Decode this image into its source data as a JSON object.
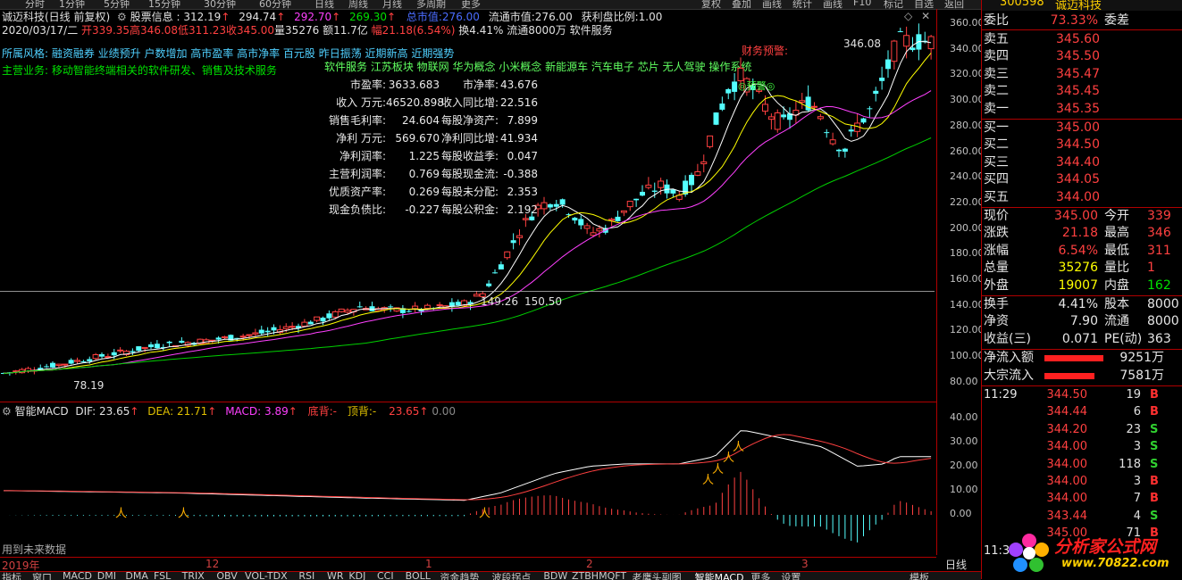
{
  "top_menu": {
    "left_items": [
      "分时",
      "1分钟",
      "5分钟",
      "15分钟",
      "30分钟",
      "60分钟",
      "日线",
      "周线",
      "月线",
      "多周期",
      "更多"
    ],
    "right_items": [
      "复权",
      "叠加",
      "画线",
      "统计",
      "画线",
      "F10",
      "标记",
      "自选",
      "返回"
    ]
  },
  "header": {
    "stock_label": "诚迈科技(日线 前复权)",
    "indicator_name": "股票信息",
    "v1": "312.19",
    "v2": "294.74",
    "v3": "292.70",
    "v4": "269.30",
    "total_mv_label": "总市值:",
    "total_mv": "276.00",
    "float_mv_label": "流通市值:",
    "float_mv": "276.00",
    "profit_ratio_label": "获利盘比例:",
    "profit_ratio": "1.00"
  },
  "quote_line": {
    "date": "2020/03/17/二",
    "open": "开339.35",
    "high": "高346.08",
    "low": "低311.23",
    "close": "收345.00",
    "volume": "量35276",
    "amount": "额11.7亿",
    "change": "幅21.18(6.54%)",
    "turnover": "换4.41%",
    "float_shares": "流通8000万",
    "industry": "软件服务"
  },
  "style_tags": "所属风格: 融资融券 业绩预升 户数增加 高市盈率 高市净率 百元股 昨日振荡 近期新高 近期强势",
  "concept_tags": "软件服务 江苏板块 物联网 华为概念 小米概念 新能源车 汽车电子 芯片 无人驾驶 操作系统",
  "main_business_label": "主营业务:",
  "main_business": "移动智能终端相关的软件研发、销售及技术服务",
  "financials": [
    {
      "k1": "市盈率:",
      "v1": "3633.683",
      "k2": "市净率:",
      "v2": "43.676"
    },
    {
      "k1": "收入 万元:",
      "v1": "46520.898",
      "k2": "收入同比增:",
      "v2": "22.516"
    },
    {
      "k1": "销售毛利率:",
      "v1": "24.604",
      "k2": "每股净资产:",
      "v2": "7.899"
    },
    {
      "k1": "净利 万元:",
      "v1": "569.670",
      "k2": "净利同比增:",
      "v2": "41.934"
    },
    {
      "k1": "净利润率:",
      "v1": "1.225",
      "k2": "每股收益季:",
      "v2": "0.047"
    },
    {
      "k1": "主营利润率:",
      "v1": "0.769",
      "k2": "每股现金流:",
      "v2": "-0.388"
    },
    {
      "k1": "优质资产率:",
      "v1": "0.269",
      "k2": "每股未分配:",
      "v2": "2.353"
    },
    {
      "k1": "现金负债比:",
      "v1": "-0.227",
      "k2": "每股公积金:",
      "v2": "2.192"
    }
  ],
  "annotations": {
    "warning": "财务预警:",
    "peak_label": "346.08",
    "mid_label1": "149.26",
    "mid_label2": "150.50",
    "low_label": "78.19",
    "circle_label": "◎预警◎"
  },
  "price_axis": [
    "360.00",
    "340.00",
    "320.00",
    "300.00",
    "280.00",
    "260.00",
    "240.00",
    "220.00",
    "200.00",
    "180.00",
    "160.00",
    "140.00",
    "120.00",
    "100.00",
    "80.00"
  ],
  "macd_axis": [
    "40.00",
    "30.00",
    "20.00",
    "10.00",
    "0.00"
  ],
  "macd": {
    "name": "智能MACD",
    "dif": "DIF: 23.65",
    "dea": "DEA: 21.71",
    "macd": "MACD: 3.89",
    "bottom_div": "底背:",
    "bottom_div_val": "-",
    "top_div": "顶背:",
    "top_div_val": "-",
    "extra1": "23.65",
    "extra2": "0.00",
    "future_note": "用到未来数据"
  },
  "date_axis": {
    "labels": [
      "2019年",
      "12",
      "1",
      "2",
      "3"
    ],
    "period_button": "日线"
  },
  "bottom_tabs": [
    "指标",
    "窗口",
    "MACD",
    "DMI",
    "DMA",
    "FSL",
    "TRIX",
    "OBV",
    "VOL-TDX",
    "RSI",
    "WR",
    "KDJ",
    "CCI",
    "BOLL",
    "资金趋势",
    "波段拐点",
    "BDW",
    "ZTBHMQFT",
    "老鹰头副图",
    "智能MACD",
    "更多",
    "设置"
  ],
  "bottom_right": "模板",
  "quote_panel": {
    "code": "300598",
    "name": "诚迈科技",
    "weibi_label": "委比",
    "weibi": "73.33%",
    "weicha_label": "委差",
    "asks": [
      {
        "label": "卖五",
        "price": "345.60"
      },
      {
        "label": "卖四",
        "price": "345.50"
      },
      {
        "label": "卖三",
        "price": "345.47"
      },
      {
        "label": "卖二",
        "price": "345.45"
      },
      {
        "label": "卖一",
        "price": "345.35"
      }
    ],
    "bids": [
      {
        "label": "买一",
        "price": "345.00"
      },
      {
        "label": "买二",
        "price": "344.50"
      },
      {
        "label": "买三",
        "price": "344.40"
      },
      {
        "label": "买四",
        "price": "344.05"
      },
      {
        "label": "买五",
        "price": "344.00"
      }
    ],
    "stats": [
      {
        "l1": "现价",
        "v1": "345.00",
        "l2": "今开",
        "v2": "339"
      },
      {
        "l1": "涨跌",
        "v1": "21.18",
        "l2": "最高",
        "v2": "346"
      },
      {
        "l1": "涨幅",
        "v1": "6.54%",
        "l2": "最低",
        "v2": "311"
      },
      {
        "l1": "总量",
        "v1": "35276",
        "l2": "量比",
        "v2": "1"
      },
      {
        "l1": "外盘",
        "v1": "19007",
        "l2": "内盘",
        "v2": "162"
      }
    ],
    "stats2": [
      {
        "l1": "换手",
        "v1": "4.41%",
        "l2": "股本",
        "v2": "8000"
      },
      {
        "l1": "净资",
        "v1": "7.90",
        "l2": "流通",
        "v2": "8000"
      },
      {
        "l1": "收益(三)",
        "v1": "0.071",
        "l2": "PE(动)",
        "v2": "363"
      }
    ],
    "flows": [
      {
        "label": "净流入额",
        "value": "9251万"
      },
      {
        "label": "大宗流入",
        "value": "7581万"
      }
    ],
    "ticks": [
      {
        "t": "11:29",
        "p": "344.50",
        "v": "19",
        "s": "B"
      },
      {
        "t": "",
        "p": "344.44",
        "v": "6",
        "s": "B"
      },
      {
        "t": "",
        "p": "344.20",
        "v": "23",
        "s": "S"
      },
      {
        "t": "",
        "p": "344.00",
        "v": "3",
        "s": "S"
      },
      {
        "t": "",
        "p": "344.00",
        "v": "118",
        "s": "S"
      },
      {
        "t": "",
        "p": "344.00",
        "v": "3",
        "s": "B"
      },
      {
        "t": "",
        "p": "344.00",
        "v": "7",
        "s": "B"
      },
      {
        "t": "",
        "p": "343.44",
        "v": "4",
        "s": "S"
      },
      {
        "t": "",
        "p": "345.00",
        "v": "71",
        "s": "B"
      },
      {
        "t": "11:30",
        "p": "",
        "v": "",
        "s": ""
      }
    ]
  },
  "watermark": {
    "site_name": "分析家公式网",
    "url": "www.70822.com"
  },
  "colors": {
    "up": "#ff4040",
    "down": "#54ffff",
    "ma5": "#ffffff",
    "ma10": "#ffff00",
    "ma20": "#ff40ff",
    "ma60": "#00d000",
    "border": "#b00000"
  }
}
